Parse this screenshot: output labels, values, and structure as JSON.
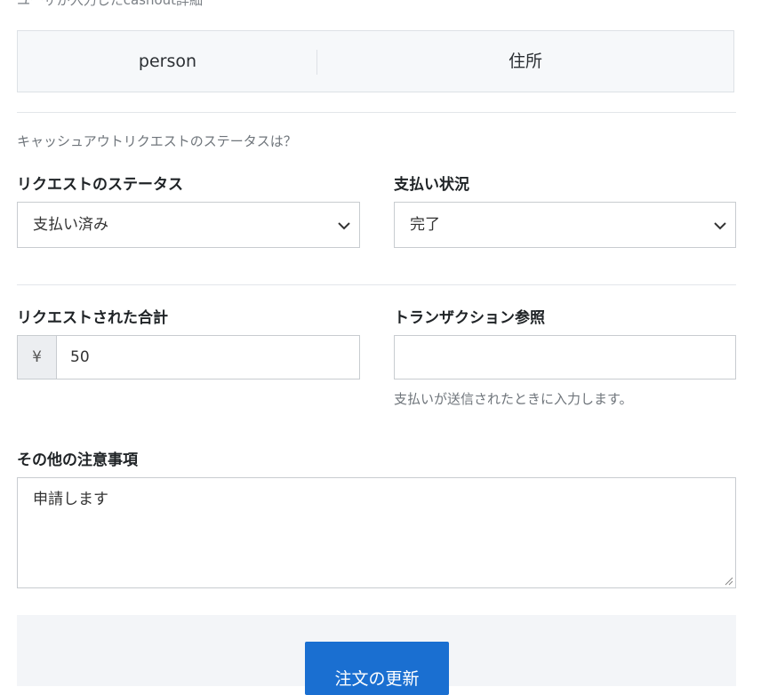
{
  "section": {
    "heading_partial": "ユーザが入力したcashout詳細"
  },
  "info": {
    "col1": "person",
    "col2": "住所"
  },
  "status_question": "キャッシュアウトリクエストのステータスは？",
  "request_status": {
    "label": "リクエストのステータス",
    "selected": "支払い済み"
  },
  "payment_status": {
    "label": "支払い状況",
    "selected": "完了"
  },
  "requested_total": {
    "label": "リクエストされた合計",
    "currency_prefix": "¥",
    "value": "50"
  },
  "transaction_ref": {
    "label": "トランザクション参照",
    "value": "",
    "help": "支払いが送信されたときに入力します。"
  },
  "notes": {
    "label": "その他の注意事項",
    "value": "申請します"
  },
  "actions": {
    "submit_label": "注文の更新"
  },
  "colors": {
    "primary_button": "#1a6fd1",
    "panel_bg": "#f6f8fa",
    "border": "#c8ccd0"
  },
  "icons": {
    "select_arrow": "chevron-down-icon",
    "textarea_grip": "resize-grip-icon"
  }
}
